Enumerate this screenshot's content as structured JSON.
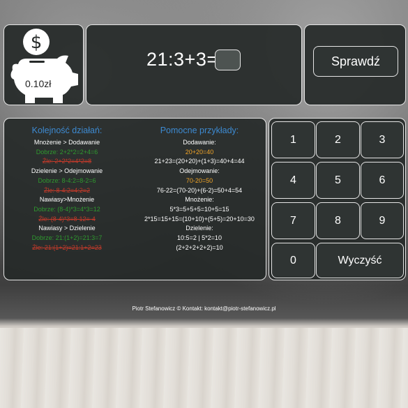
{
  "bank": {
    "amount": "0.10zł"
  },
  "equation": {
    "text": "21:3+3=",
    "answer_value": ""
  },
  "check_button": "Sprawdź",
  "rules": {
    "left_title": "Kolejność działań:",
    "left_lines": [
      {
        "text": "Mnożenie > Dodawanie",
        "style": "w"
      },
      {
        "text": "Dobrze: 2+2*2=2+4=6",
        "style": "g"
      },
      {
        "text": "Źle: 2+2*2=4*2=8",
        "style": "r"
      },
      {
        "text": "Dzielenie > Odejmowanie",
        "style": "w"
      },
      {
        "text": "Dobrze: 8-4:2=8-2=6",
        "style": "g"
      },
      {
        "text": "Źle: 8-4:2=4:2=2",
        "style": "r"
      },
      {
        "text": "Nawiasy>Mnożenie",
        "style": "w"
      },
      {
        "text": "Dobrze: (8-4)*3=4*3=12",
        "style": "g"
      },
      {
        "text": "Źle: (8-4)*3=8-12=-4",
        "style": "r"
      },
      {
        "text": "Nawiasy > Dzielenie",
        "style": "w"
      },
      {
        "text": "Dobrze: 21:(1+2)=21:3=7",
        "style": "g"
      },
      {
        "text": "Źle: 21:(1+2)=21:1+2=23",
        "style": "r"
      }
    ],
    "right_title": "Pomocne przykłady:",
    "right_lines": [
      {
        "text": "Dodawanie:",
        "style": "w"
      },
      {
        "text": "20+20=40",
        "style": "o"
      },
      {
        "text": "21+23=(20+20)+(1+3)=40+4=44",
        "style": "w"
      },
      {
        "text": "Odejmowanie:",
        "style": "w"
      },
      {
        "text": "70-20=50",
        "style": "o"
      },
      {
        "text": "76-22=(70-20)+(6-2)=50+4=54",
        "style": "w"
      },
      {
        "text": "Mnożenie:",
        "style": "w"
      },
      {
        "text": "5*3=5+5+5=10+5=15",
        "style": "w"
      },
      {
        "text": "2*15=15+15=(10+10)+(5+5)=20+10=30",
        "style": "w"
      },
      {
        "text": "Dzielenie:",
        "style": "w"
      },
      {
        "text": "10:5=2 | 5*2=10",
        "style": "w"
      },
      {
        "text": "(2+2+2+2+2)=10",
        "style": "w"
      }
    ]
  },
  "keypad": {
    "k1": "1",
    "k2": "2",
    "k3": "3",
    "k4": "4",
    "k5": "5",
    "k6": "6",
    "k7": "7",
    "k8": "8",
    "k9": "9",
    "k0": "0",
    "clear": "Wyczyść"
  },
  "footer": "Piotr Stefanowicz © Kontakt: kontakt@piotr-stefanowicz.pl",
  "icons": {
    "bank": "piggy-bank-dollar-icon"
  },
  "colors": {
    "panel": "#262a29",
    "border": "#e6e6e6",
    "heading": "#3d8ad1",
    "correct": "#2f9a2f",
    "wrong": "#c43a2a",
    "accent": "#f0a428"
  }
}
